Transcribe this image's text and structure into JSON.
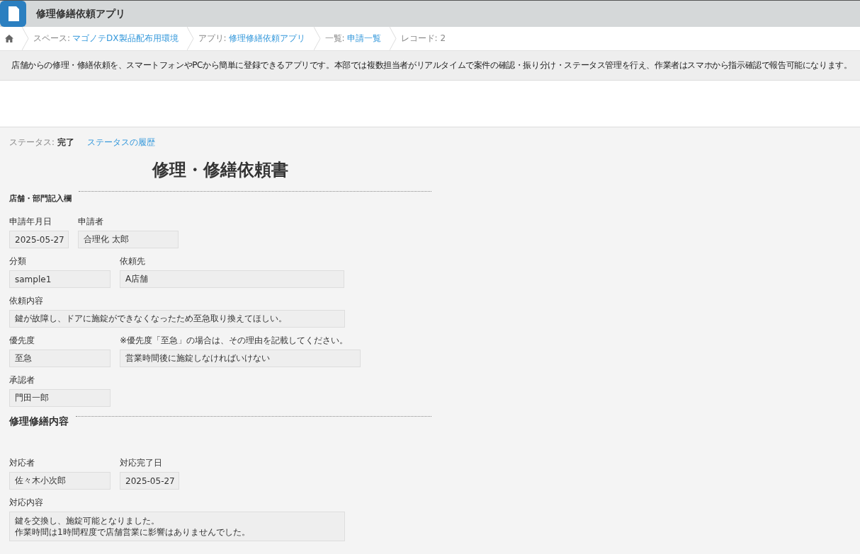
{
  "header": {
    "app_title": "修理修繕依頼アプリ"
  },
  "breadcrumbs": [
    {
      "prefix": "スペース:",
      "link": "マゴノテDX製品配布用環境"
    },
    {
      "prefix": "アプリ:",
      "link": "修理修繕依頼アプリ"
    },
    {
      "prefix": "一覧:",
      "link": "申請一覧"
    },
    {
      "prefix": "レコード: 2"
    }
  ],
  "description": "店舗からの修理・修繕依頼を、スマートフォンやPCから簡単に登録できるアプリです。本部では複数担当者がリアルタイムで案件の確認・振り分け・ステータス管理を行え、作業者はスマホから指示確認で報告可能になります。",
  "status": {
    "label": "ステータス:",
    "value": "完了",
    "history_link": "ステータスの履歴"
  },
  "form": {
    "title": "修理・修繕依頼書",
    "sections": [
      {
        "heading": "店舗・部門記入欄",
        "kind": "small",
        "rows": [
          [
            {
              "label": "申請年月日",
              "value": "2025-05-27",
              "kind": "date"
            },
            {
              "label": "申請者",
              "value": "合理化 太郎",
              "kind": "name"
            }
          ],
          [
            {
              "label": "分類",
              "value": "sample1",
              "kind": "select"
            },
            {
              "label": "依頼先",
              "value": "A店舗",
              "kind": "text"
            }
          ],
          [
            {
              "label": "依頼内容",
              "value": "鍵が故障し、ドアに施錠ができなくなったため至急取り換えてほしい。",
              "kind": "wide"
            }
          ],
          [
            {
              "label": "優先度",
              "value": "至急",
              "kind": "select"
            },
            {
              "label": "※優先度「至急」の場合は、その理由を記載してください。",
              "value": "営業時間後に施錠しなければいけない",
              "kind": "reason"
            }
          ],
          [
            {
              "label": "承認者",
              "value": "門田一郎",
              "kind": "select"
            }
          ]
        ]
      },
      {
        "heading": "修理修繕内容",
        "kind": "large",
        "rows": [
          [
            {
              "label": "対応者",
              "value": "佐々木小次郎",
              "kind": "select"
            },
            {
              "label": "対応完了日",
              "value": "2025-05-27",
              "kind": "date"
            }
          ],
          [
            {
              "label": "対応内容",
              "lines": [
                "鍵を交換し、施錠可能となりました。",
                "作業時間は1時間程度で店舗営業に影響はありませんでした。"
              ],
              "kind": "textarea"
            }
          ]
        ]
      }
    ]
  }
}
